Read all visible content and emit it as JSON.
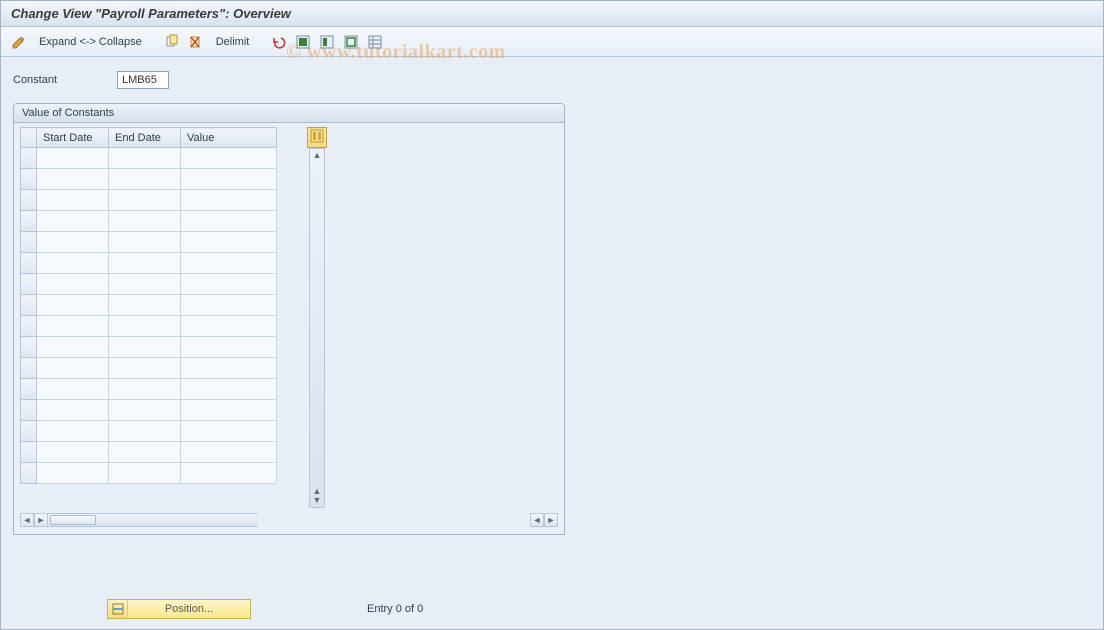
{
  "title": "Change View \"Payroll Parameters\": Overview",
  "toolbar": {
    "expand_collapse_label": "Expand <-> Collapse",
    "delimit_label": "Delimit"
  },
  "form": {
    "constant_label": "Constant",
    "constant_value": "LMB65"
  },
  "panel": {
    "title": "Value of Constants",
    "columns": {
      "start": "Start Date",
      "end": "End Date",
      "value": "Value"
    }
  },
  "footer": {
    "position_label": "Position...",
    "entry_status": "Entry 0 of 0"
  },
  "watermark": "© www.tutorialkart.com"
}
